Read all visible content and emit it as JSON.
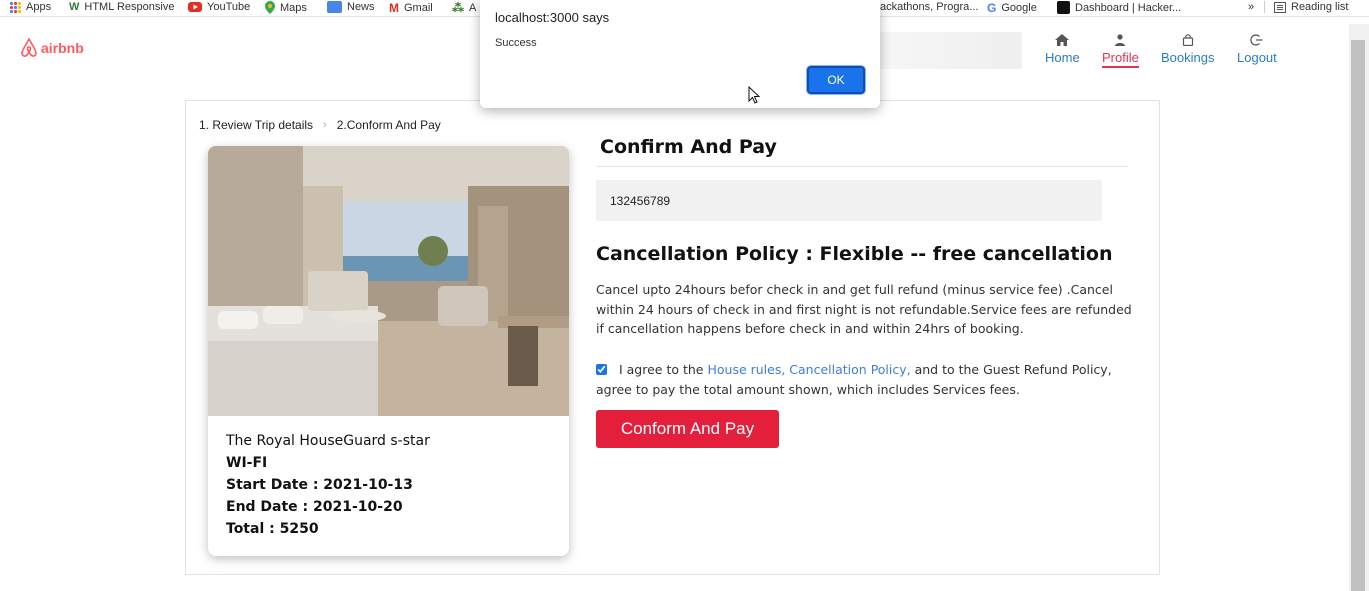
{
  "bookmarks": {
    "apps": "Apps",
    "html_responsive": "HTML Responsive",
    "youtube": "YouTube",
    "maps": "Maps",
    "news": "News",
    "gmail": "Gmail",
    "a_item": "A",
    "hackathons": "ackathons, Progra...",
    "google": "Google",
    "dashboard": "Dashboard | Hacker...",
    "more": "»",
    "reading_list": "Reading list"
  },
  "header": {
    "logo_text": "airbnb",
    "nav": {
      "home": "Home",
      "profile": "Profile",
      "bookings": "Bookings",
      "logout": "Logout"
    }
  },
  "breadcrumb": {
    "step1": "1. Review Trip details",
    "step2": "2.Conform And Pay"
  },
  "room": {
    "name": "The Royal HouseGuard s-star",
    "amenity": "WI-FI",
    "start_date": "Start Date : 2021-10-13",
    "end_date": "End Date : 2021-10-20",
    "total": "Total : 5250"
  },
  "payment": {
    "title": "Confirm And Pay",
    "card_value": "132456789",
    "policy_title": "Cancellation Policy : Flexible -- free cancellation",
    "policy_text": "Cancel upto 24hours befor check in and get full refund (minus service fee) .Cancel within 24 hours of check in and first night is not refundable.Service fees are refunded if cancellation happens before check in and within 24hrs of booking.",
    "agree_prefix": "I agree to the ",
    "agree_link": "House rules, Cancellation Policy,",
    "agree_suffix": " and to the Guest Refund Policy, agree to pay the total amount shown, which includes Services fees.",
    "agree_checked": true,
    "button": "Conform And Pay"
  },
  "dialog": {
    "title": "localhost:3000 says",
    "message": "Success",
    "ok": "OK"
  },
  "colors": {
    "brand": "#ff5a5f",
    "nav_link": "#2b7bcf",
    "active": "#e4344d",
    "pay_button": "#e41f3c",
    "ok_button": "#1a73e8"
  }
}
